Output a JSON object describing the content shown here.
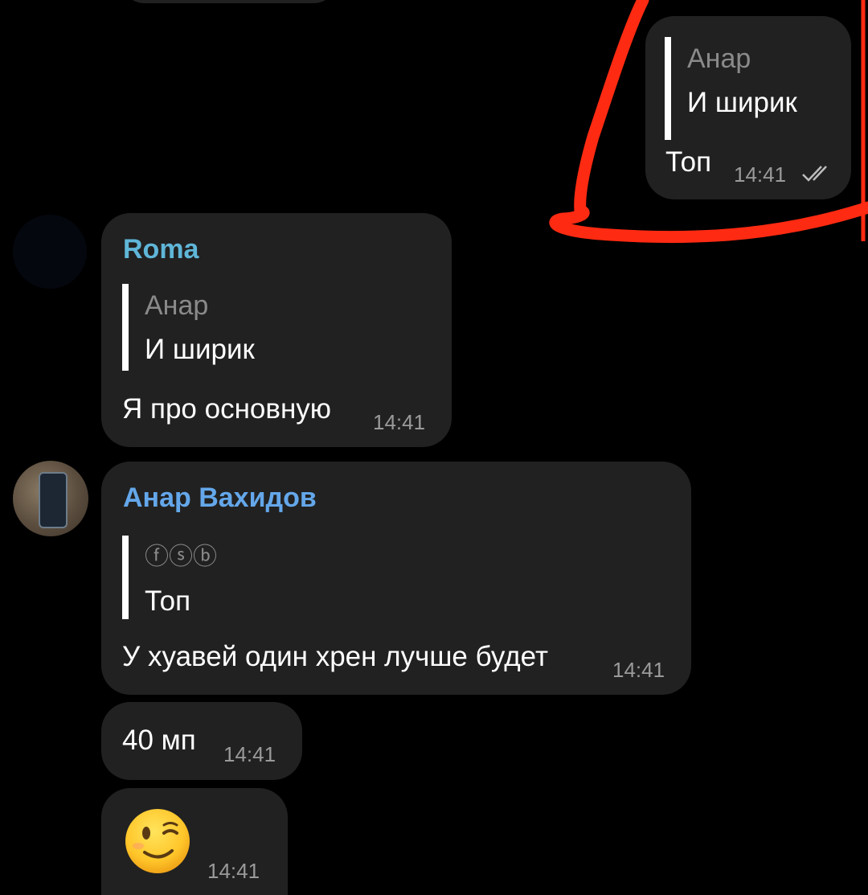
{
  "messages": {
    "outgoing": {
      "quote_author": "Анар",
      "quote_text": "И ширик",
      "text": "Топ",
      "time": "14:41",
      "status_icon": "double-check-icon"
    },
    "roma": {
      "sender": "Roma",
      "sender_color": "#64b5f6",
      "quote_author": "Анар",
      "quote_text": "И ширик",
      "text": "Я про основную",
      "time": "14:41"
    },
    "anar": {
      "sender": "Анар Вахидов",
      "sender_color": "#64a7ea",
      "quote_author": "ⓕⓢⓑ",
      "quote_text": "Топ",
      "text": "У хуавей один хрен лучше будет",
      "time": "14:41"
    },
    "anar_followup_1": {
      "text": "40 мп",
      "time": "14:41"
    },
    "anar_followup_2": {
      "emoji": "winking-face-emoji",
      "time": "14:41"
    }
  },
  "annotation": {
    "color": "#ff2a12"
  }
}
